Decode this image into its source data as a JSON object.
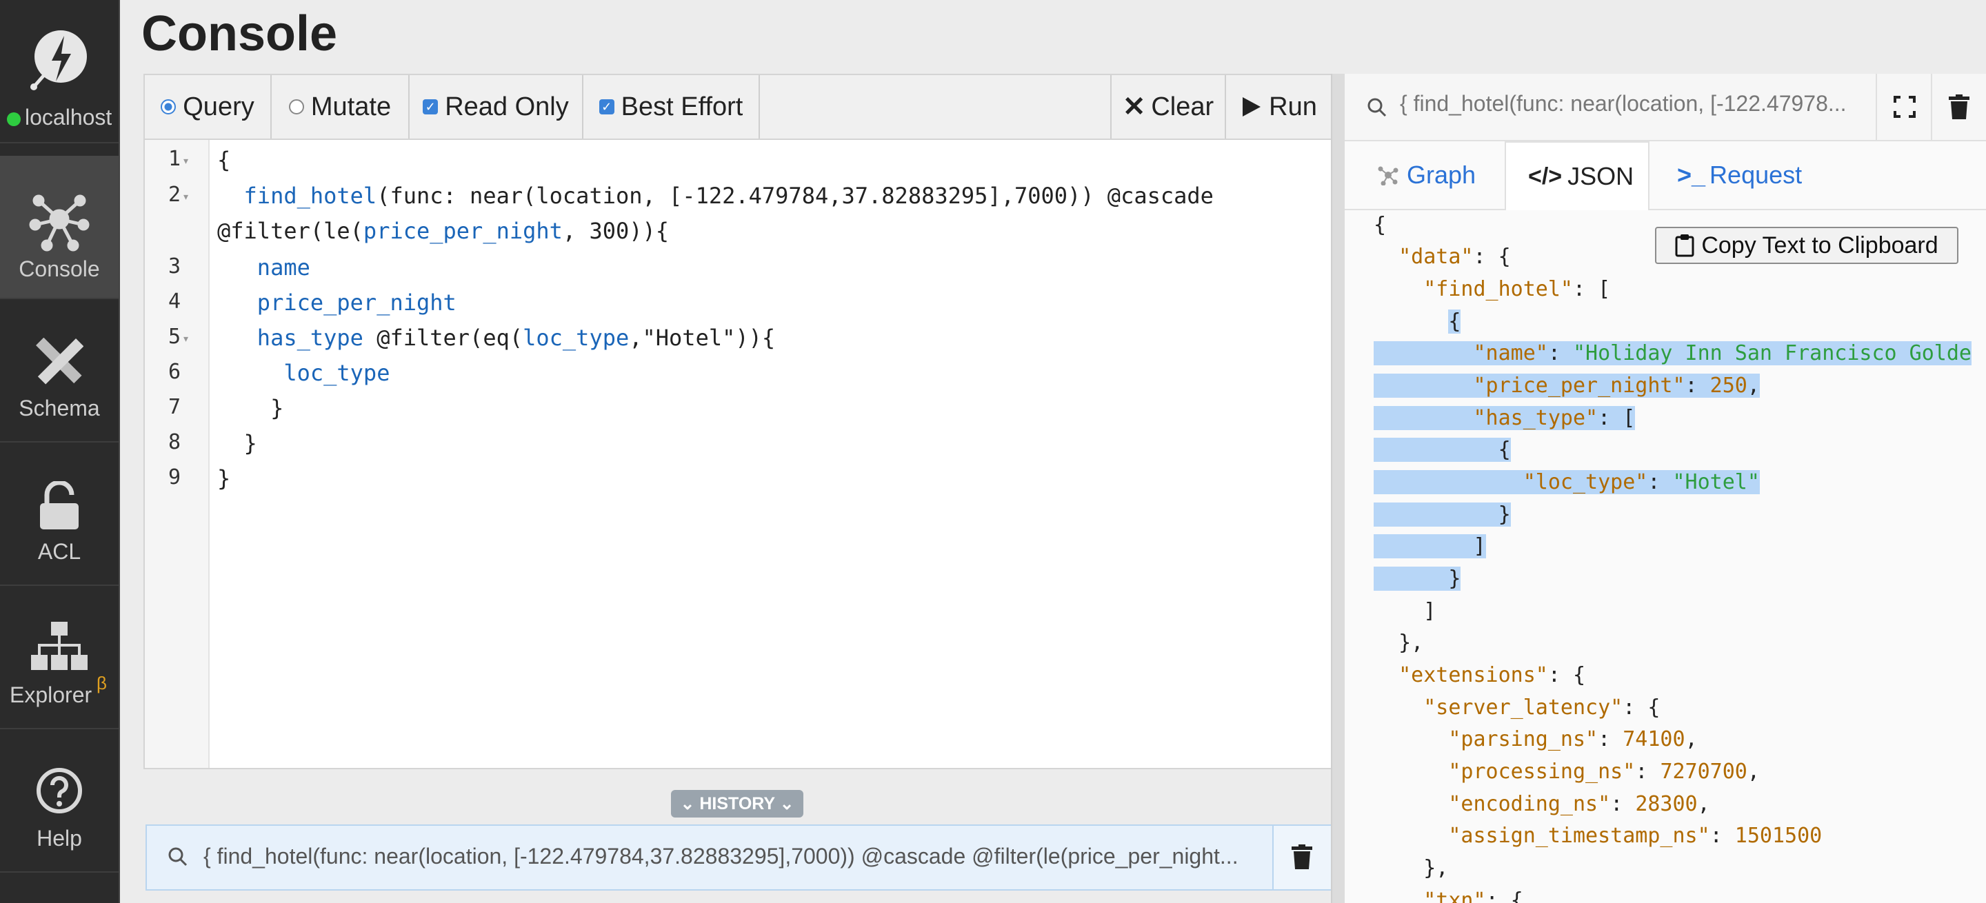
{
  "sidebar": {
    "server": "localhost",
    "items": [
      {
        "label": "Console",
        "icon": "nodes-icon"
      },
      {
        "label": "Schema",
        "icon": "pencil-ruler-icon"
      },
      {
        "label": "ACL",
        "icon": "unlock-icon"
      },
      {
        "label": "Explorer",
        "icon": "sitemap-icon",
        "badge": "β"
      },
      {
        "label": "Help",
        "icon": "help-icon"
      }
    ]
  },
  "page_title": "Console",
  "toolbar": {
    "query_label": "Query",
    "mutate_label": "Mutate",
    "readonly_label": "Read Only",
    "besteffort_label": "Best Effort",
    "clear_label": "Clear",
    "run_label": "Run",
    "selected_mode": "Query",
    "read_only_checked": true,
    "best_effort_checked": true
  },
  "editor": {
    "line_numbers": [
      "1",
      "2",
      "3",
      "4",
      "5",
      "6",
      "7",
      "8",
      "9"
    ],
    "lines": [
      "{",
      "  find_hotel(func: near(location, [-122.479784,37.82883295],7000)) @cascade",
      "@filter(le(price_per_night, 300)){",
      "   name",
      "   price_per_night",
      "   has_type @filter(eq(loc_type,\"Hotel\")){",
      "     loc_type",
      "    }",
      "  }",
      "}"
    ]
  },
  "history": {
    "label": "HISTORY",
    "entry": "{ find_hotel(func: near(location, [-122.479784,37.82883295],7000)) @cascade @filter(le(price_per_night..."
  },
  "results": {
    "search_text": "{ find_hotel(func: near(location, [-122.47978...",
    "tabs": [
      "Graph",
      "JSON",
      "Request"
    ],
    "active_tab": "JSON",
    "copy_label": "Copy Text to Clipboard",
    "json_lines": [
      "{",
      "  \"data\": {",
      "    \"find_hotel\": [",
      "      {",
      "        \"name\": \"Holiday Inn San Francisco Golde",
      "        \"price_per_night\": 250,",
      "        \"has_type\": [",
      "          {",
      "            \"loc_type\": \"Hotel\"",
      "          }",
      "        ]",
      "      }",
      "    ]",
      "  },",
      "  \"extensions\": {",
      "    \"server_latency\": {",
      "      \"parsing_ns\": 74100,",
      "      \"processing_ns\": 7270700,",
      "      \"encoding_ns\": 28300,",
      "      \"assign_timestamp_ns\": 1501500",
      "    },",
      "    \"txn\": {"
    ]
  },
  "colors": {
    "accent": "#3a82d8",
    "sidebar_bg": "#2b2b2b",
    "selection": "#b7d6f7",
    "status_online": "#2ecc40"
  }
}
